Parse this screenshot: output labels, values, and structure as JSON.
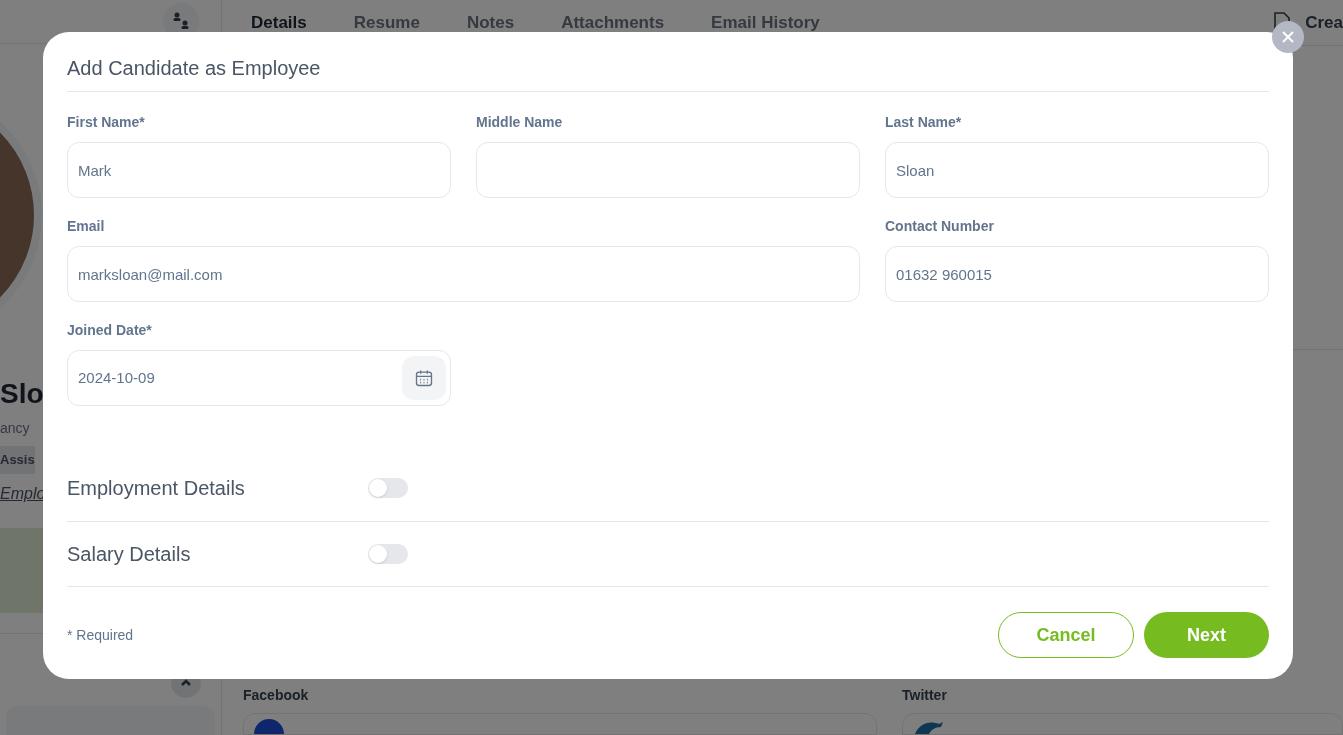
{
  "background": {
    "tabs": [
      {
        "label": "Details",
        "selected": true
      },
      {
        "label": "Resume",
        "selected": false
      },
      {
        "label": "Notes",
        "selected": false
      },
      {
        "label": "Attachments",
        "selected": false
      },
      {
        "label": "Email History",
        "selected": false
      }
    ],
    "create_button": "Crea",
    "profile": {
      "name": "Slo",
      "company": "ancy",
      "job_badge": "Assis",
      "employee_link": "Emplo"
    },
    "social": [
      {
        "kind": "facebook",
        "label": "Facebook"
      },
      {
        "kind": "twitter",
        "label": "Twitter"
      }
    ]
  },
  "dialog": {
    "title": "Add Candidate as Employee",
    "fields": [
      {
        "label": "First Name*",
        "value": "Mark",
        "kind": "text"
      },
      {
        "label": "Middle Name",
        "kind": "text"
      },
      {
        "label": "Last Name*",
        "value": "Sloan",
        "kind": "text"
      },
      {
        "label": "Email",
        "value": "marksloan@mail.com",
        "kind": "email"
      },
      {
        "label": "Contact Number",
        "value": "01632 960015",
        "kind": "text"
      },
      {
        "label": "Joined Date*",
        "value": "2024-10-09",
        "kind": "date"
      }
    ],
    "sections": [
      {
        "label": "Employment Details",
        "on": false
      },
      {
        "label": "Salary Details",
        "on": false
      }
    ],
    "required_note": "* Required",
    "buttons": [
      {
        "label": "Cancel",
        "kind": "secondary"
      },
      {
        "label": "Next",
        "kind": "primary"
      }
    ]
  }
}
